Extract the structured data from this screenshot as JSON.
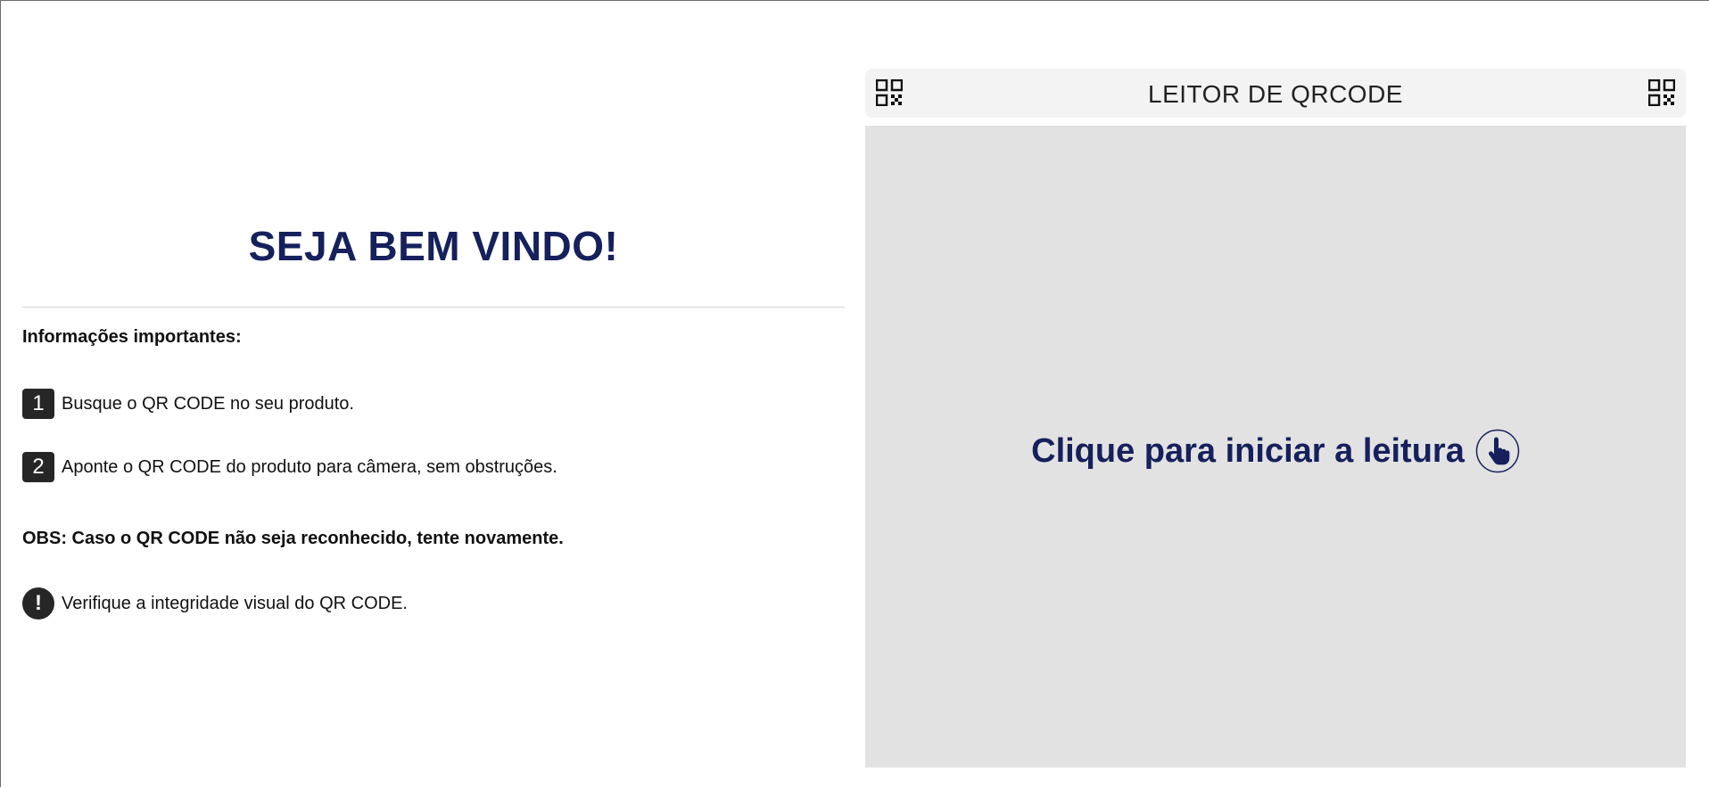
{
  "welcome": {
    "title": "SEJA BEM VINDO!",
    "info_heading": "Informações importantes:",
    "steps": [
      {
        "number": "1",
        "text": "Busque o QR CODE no seu produto."
      },
      {
        "number": "2",
        "text": "Aponte o QR CODE do produto para câmera, sem obstruções."
      }
    ],
    "obs": "OBS: Caso o QR CODE não seja reconhecido, tente novamente.",
    "alert": {
      "icon": "!",
      "text": "Verifique a integridade visual do QR CODE."
    }
  },
  "reader": {
    "title": "LEITOR DE QRCODE",
    "left_icon": "qrcode-icon",
    "right_icon": "qrcode-icon",
    "start_label": "Clique para iniciar a leitura",
    "start_icon": "pointer-hand-icon"
  },
  "colors": {
    "brand": "#15205c",
    "reader_bg": "#e2e2e2",
    "header_bg": "#f3f3f3",
    "badge": "#262626"
  }
}
